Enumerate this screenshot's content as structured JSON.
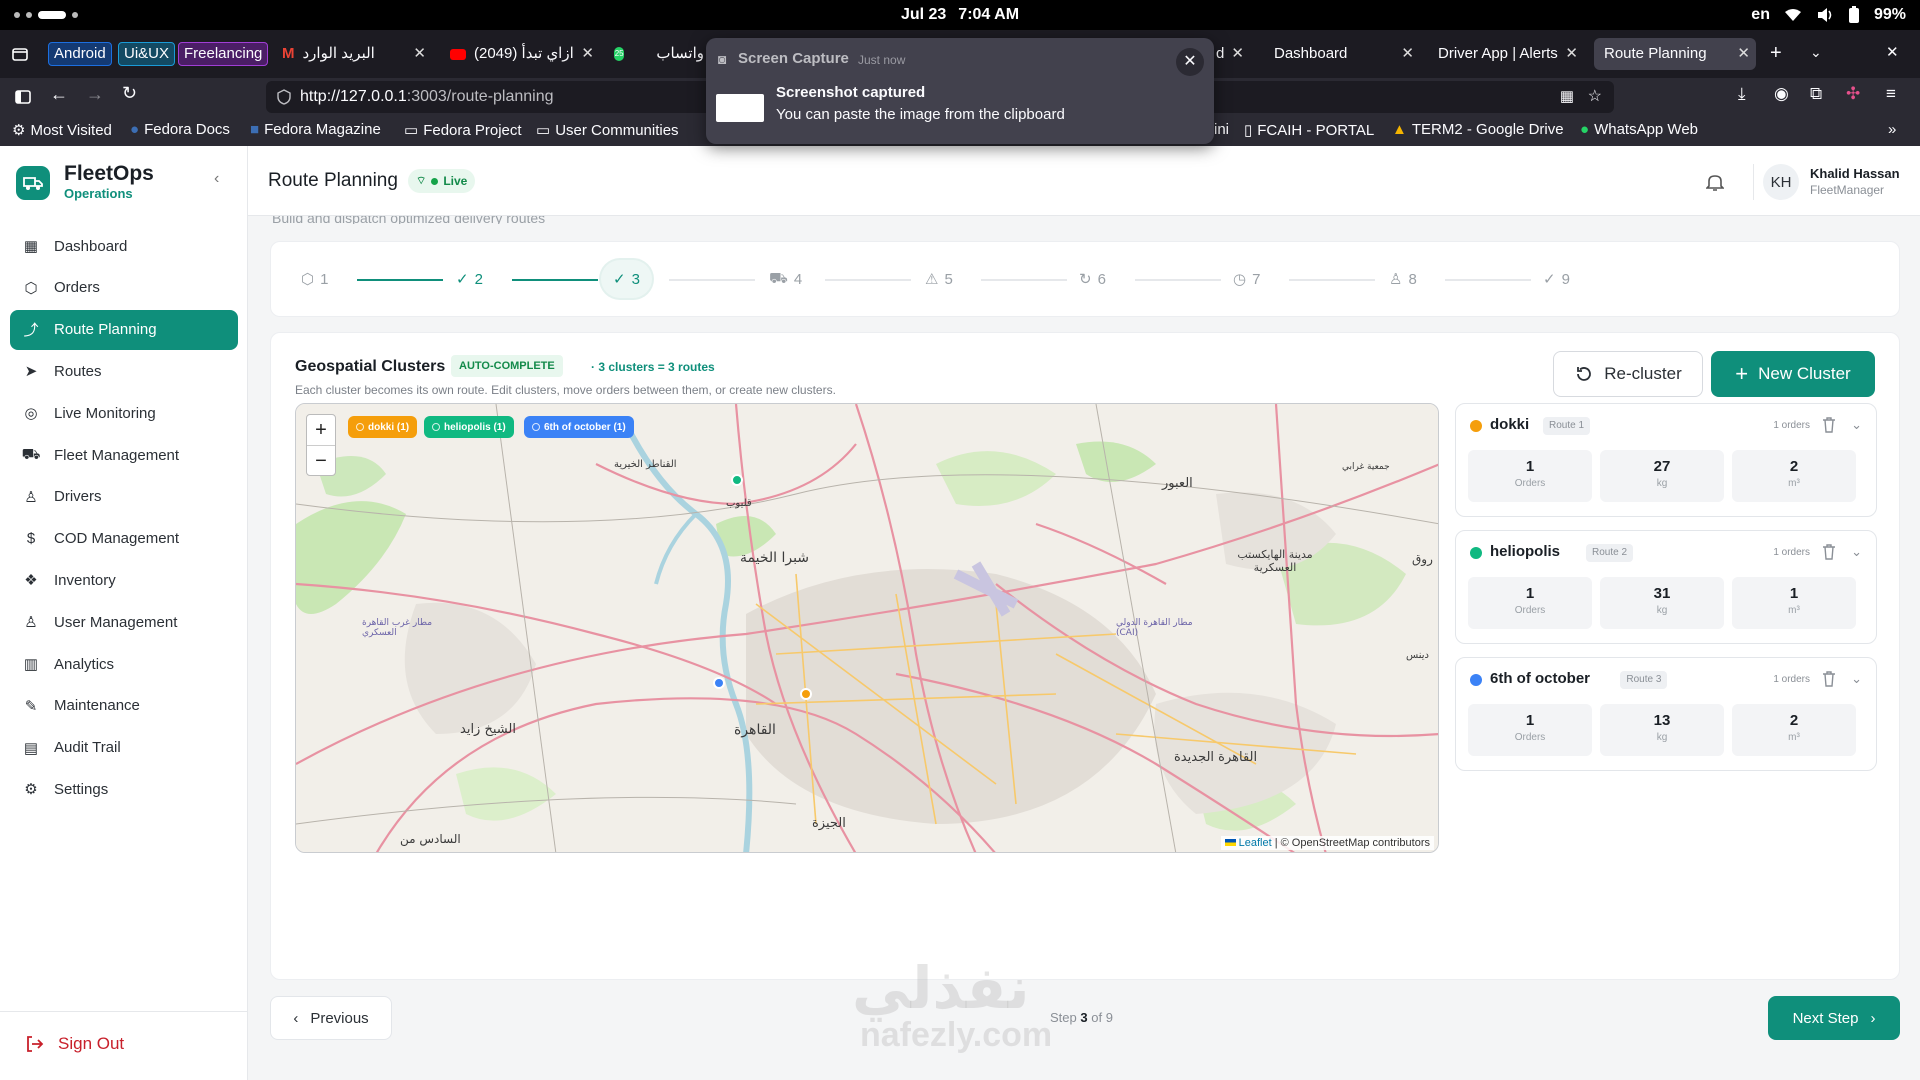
{
  "os": {
    "date": "Jul 23",
    "time": "7:04 AM",
    "lang": "en",
    "battery": "99%"
  },
  "tabs": {
    "pinned": [
      {
        "label": "Android",
        "color": "#1c6fe0"
      },
      {
        "label": "Ui&UX",
        "color": "#1a9bd7"
      },
      {
        "label": "Freelancing",
        "color": "#a13ed6"
      }
    ],
    "items": [
      {
        "label": "البريد الوارد"
      },
      {
        "label": "(2049) ازاي تبدأ"
      },
      {
        "label": "واتساب"
      },
      {
        "label": "d"
      },
      {
        "label": "Dashboard"
      },
      {
        "label": "Driver App | Alerts"
      },
      {
        "label": "Route Planning"
      }
    ]
  },
  "nav": {
    "url_host": "http://127.0.0.1",
    "url_path": ":3003/route-planning"
  },
  "bookmarks": [
    "Most Visited",
    "Fedora Docs",
    "Fedora Magazine",
    "Fedora Project",
    "User Communities",
    "ini",
    "FCAIH - PORTAL",
    "TERM2 - Google Drive",
    "WhatsApp Web"
  ],
  "notification": {
    "app": "Screen Capture",
    "when": "Just now",
    "title": "Screenshot captured",
    "body": "You can paste the image from the clipboard"
  },
  "sidebar": {
    "brand": "FleetOps",
    "brand_sub": "Operations",
    "items": [
      {
        "label": "Dashboard",
        "icon": "grid-icon"
      },
      {
        "label": "Orders",
        "icon": "box-icon"
      },
      {
        "label": "Route Planning",
        "icon": "route-icon"
      },
      {
        "label": "Routes",
        "icon": "navigation-icon"
      },
      {
        "label": "Live Monitoring",
        "icon": "radio-icon"
      },
      {
        "label": "Fleet Management",
        "icon": "truck-icon"
      },
      {
        "label": "Drivers",
        "icon": "user-icon"
      },
      {
        "label": "COD Management",
        "icon": "dollar-icon"
      },
      {
        "label": "Inventory",
        "icon": "boxes-icon"
      },
      {
        "label": "User Management",
        "icon": "users-icon"
      },
      {
        "label": "Analytics",
        "icon": "chart-icon"
      },
      {
        "label": "Maintenance",
        "icon": "wrench-icon"
      },
      {
        "label": "Audit Trail",
        "icon": "clipboard-icon"
      },
      {
        "label": "Settings",
        "icon": "gear-icon"
      }
    ],
    "sign_out": "Sign Out"
  },
  "header": {
    "title": "Route Planning",
    "live": "Live",
    "user_initials": "KH",
    "user_name": "Khalid Hassan",
    "user_role": "FleetManager",
    "subtitle": "Build and dispatch optimized delivery routes"
  },
  "stepper": {
    "steps": [
      {
        "label": "1",
        "icon": "package-icon",
        "state": "upcoming"
      },
      {
        "label": "2",
        "icon": "check-icon",
        "state": "done"
      },
      {
        "label": "3",
        "icon": "check-icon",
        "state": "current"
      },
      {
        "label": "4",
        "icon": "truck-icon",
        "state": "upcoming"
      },
      {
        "label": "5",
        "icon": "alert-icon",
        "state": "upcoming"
      },
      {
        "label": "6",
        "icon": "refresh-icon",
        "state": "upcoming"
      },
      {
        "label": "7",
        "icon": "clock-icon",
        "state": "upcoming"
      },
      {
        "label": "8",
        "icon": "user-icon",
        "state": "upcoming"
      },
      {
        "label": "9",
        "icon": "check-circle-icon",
        "state": "upcoming"
      }
    ]
  },
  "clusters_section": {
    "title": "Geospatial Clusters",
    "badge": "AUTO-COMPLETE",
    "info": "3 clusters = 3 routes",
    "description": "Each cluster becomes its own route. Edit clusters, move orders between them, or create new clusters.",
    "recluster": "Re-cluster",
    "new_cluster": "New Cluster"
  },
  "map": {
    "chips": [
      {
        "label": "dokki (1)",
        "color": "#f59e0b"
      },
      {
        "label": "heliopolis (1)",
        "color": "#10b981"
      },
      {
        "label": "6th of october (1)",
        "color": "#3b82f6"
      }
    ],
    "attribution_link": "Leaflet",
    "attribution": "| © OpenStreetMap contributors",
    "labels": [
      "القناطر الخيرية",
      "شبرا الخيمة",
      "العبور",
      "مدينة الهايكستب العسكرية",
      "مطار القاهرة الدولي (CAI)",
      "مطار غرب القاهرة العسكري",
      "الشيخ زايد",
      "القاهرة",
      "القاهرة الجديدة",
      "الجيزة",
      "السادس من",
      "قليوب",
      "جمعية غرابي",
      "دينس",
      "روق"
    ]
  },
  "clusters": [
    {
      "name": "dokki",
      "route": "Route 1",
      "orders_text": "1 orders",
      "color": "#f59e0b",
      "orders": "1",
      "weight": "27",
      "volume": "2"
    },
    {
      "name": "heliopolis",
      "route": "Route 2",
      "orders_text": "1 orders",
      "color": "#10b981",
      "orders": "1",
      "weight": "31",
      "volume": "1"
    },
    {
      "name": "6th of october",
      "route": "Route 3",
      "orders_text": "1 orders",
      "color": "#3b82f6",
      "orders": "1",
      "weight": "13",
      "volume": "2"
    }
  ],
  "stat_labels": {
    "orders": "Orders",
    "weight": "kg",
    "volume": "m³"
  },
  "footer": {
    "previous": "Previous",
    "step_prefix": "Step",
    "step_current": "3",
    "step_suffix": "of 9",
    "next": "Next Step"
  },
  "watermark": {
    "text": "نفذلي",
    "site": "nafezly.com"
  }
}
